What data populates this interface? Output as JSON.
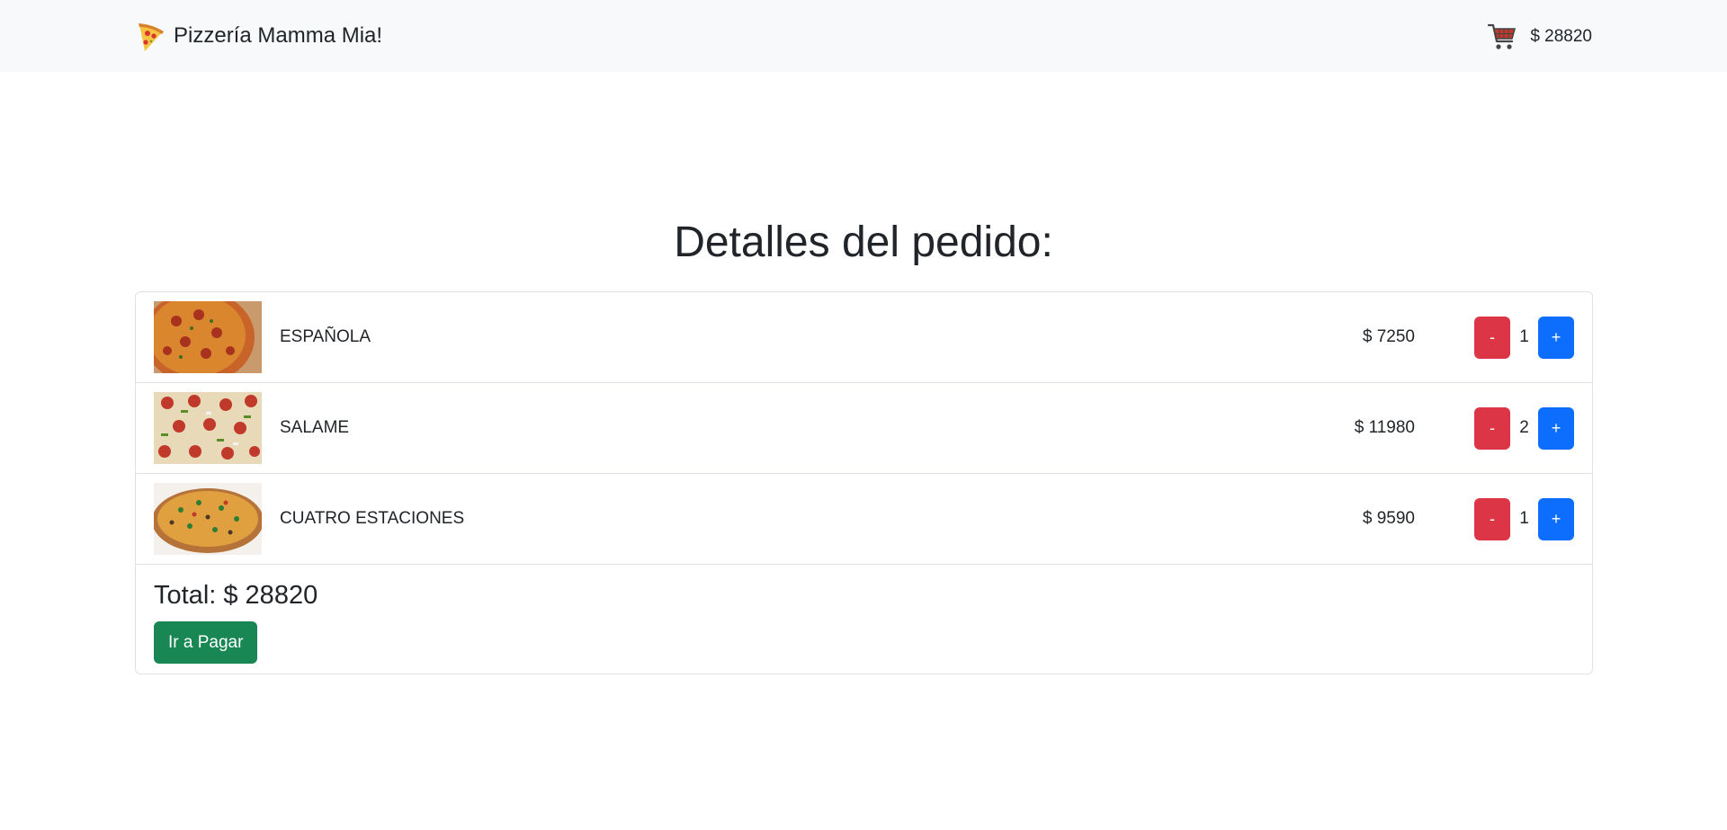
{
  "navbar": {
    "brand_icon": "pizza-slice-icon",
    "brand_label": "Pizzería Mamma Mia!",
    "cart_icon": "shopping-cart-icon",
    "cart_total": "$ 28820"
  },
  "main": {
    "title": "Detalles del pedido:",
    "items": [
      {
        "name": "ESPAÑOLA",
        "price": "$ 7250",
        "quantity": "1",
        "minus_label": "-",
        "plus_label": "+"
      },
      {
        "name": "SALAME",
        "price": "$ 11980",
        "quantity": "2",
        "minus_label": "-",
        "plus_label": "+"
      },
      {
        "name": "CUATRO ESTACIONES",
        "price": "$ 9590",
        "quantity": "1",
        "minus_label": "-",
        "plus_label": "+"
      }
    ],
    "total_label": "Total: $ 28820",
    "pay_label": "Ir a Pagar"
  },
  "colors": {
    "navbar_bg": "#f8f9fa",
    "danger": "#dc3545",
    "primary": "#0d6efd",
    "success": "#198754",
    "border": "#dee2e6"
  }
}
